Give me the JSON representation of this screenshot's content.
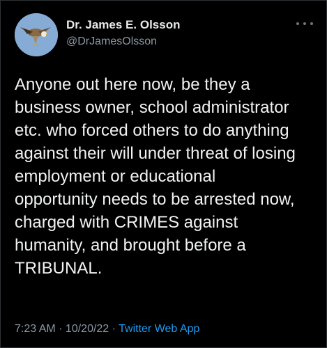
{
  "tweet": {
    "author": {
      "display_name": "Dr. James E. Olsson",
      "handle": "@DrJamesOlsson",
      "avatar_icon": "bird-of-prey-avatar"
    },
    "more_icon": "more-options-icon",
    "text": "Anyone out here now, be they a\nbusiness owner, school administrator\netc. who forced others to do anything\nagainst their will under threat of losing\nemployment or educational\nopportunity needs to be arrested now,\ncharged with CRIMES against\nhumanity, and brought before a\nTRIBUNAL.",
    "meta": {
      "time": "7:23 AM",
      "separator1": " · ",
      "date": "10/20/22",
      "separator2": " · ",
      "source": "Twitter Web App"
    }
  },
  "colors": {
    "background": "#000000",
    "text": "#e7e9ea",
    "muted": "#8b98a5",
    "link": "#1d9bf0"
  }
}
